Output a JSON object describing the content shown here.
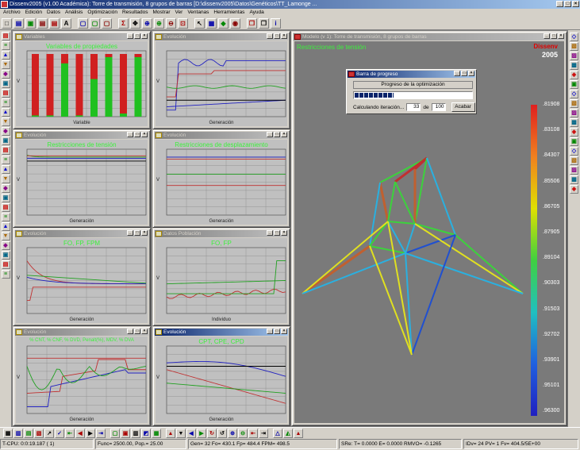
{
  "app": {
    "title": "Dissenv2005 (v1.00 Académica): Torre de transmisión, 8 grupos de barras [D:\\dissenv2005\\Datos\\Genéticos\\TT_Lamonge ...",
    "menu": [
      "Archivo",
      "Edición",
      "Datos",
      "Análisis",
      "Optimización",
      "Resultados",
      "Mostrar",
      "Ver",
      "Ventanas",
      "Herramientas",
      "Ayuda"
    ]
  },
  "toolbar": {
    "icons": [
      "new-icon",
      "open-icon",
      "save-icon",
      "print-icon",
      "print-icon",
      "text-icon",
      "frame-icon",
      "frame-icon",
      "frame-icon",
      "calc-icon",
      "move-icon",
      "zoom-icon",
      "zoom-in-icon",
      "zoom-out-icon",
      "zoom-fit-icon",
      "select-icon",
      "grid-icon",
      "render-icon",
      "color-icon",
      "cube-icon",
      "cube-icon",
      "info-icon"
    ],
    "glyphs": [
      "□",
      "▤",
      "▣",
      "▤",
      "▤",
      "A",
      "▢",
      "▢",
      "▢",
      "Σ",
      "✥",
      "⊕",
      "⊕",
      "⊖",
      "⊡",
      "↖",
      "▦",
      "◆",
      "◉",
      "❒",
      "❒",
      "i"
    ]
  },
  "windows": {
    "variables": {
      "title": "Variables",
      "plot_title": "Variables de propiedades",
      "xlabel": "Variable",
      "ylabel": "V",
      "colors": {
        "bar": "#d02020",
        "fill": "#20c020",
        "top": "#40ff40"
      }
    },
    "evol1": {
      "title": "Evolución",
      "xlabel": "Generación",
      "ylabel": "V"
    },
    "tension": {
      "title": "Evolución",
      "plot_title": "Restricciones de tensión",
      "xlabel": "Generación",
      "ylabel": "V"
    },
    "desplaz": {
      "title": "Evolución",
      "plot_title": "Restricciones de desplazamiento",
      "xlabel": "Generación",
      "ylabel": "V"
    },
    "fo": {
      "title": "Evolución",
      "plot_title": "FO, FP, FPM",
      "xlabel": "Generación",
      "ylabel": "V"
    },
    "poblacion": {
      "title": "Datos Población",
      "plot_title": "FO, FP",
      "xlabel": "Individuo",
      "ylabel": "V"
    },
    "pct": {
      "title": "Evolución",
      "plot_title": "% CNT, % CNF, % DVD, Penalt(%), MDV, % DVA",
      "xlabel": "Generación",
      "ylabel": "V"
    },
    "cpt": {
      "title": "Evolución",
      "plot_title": "CPT, CPE, CPD",
      "xlabel": "Generación",
      "ylabel": "V"
    },
    "model": {
      "title": "Modelo (v 1): Torre de transmisión, 8 grupos de barras",
      "subtitle": "Restricciones de tensión",
      "brand": "Dissenv",
      "year": "2005",
      "scale": [
        ".81908",
        ".83108",
        ".84307",
        ".85506",
        ".86705",
        ".87905",
        ".89104",
        ".90303",
        ".91503",
        ".92702",
        ".93901",
        ".95101",
        ".96300"
      ]
    }
  },
  "progress": {
    "title": "Barra de progreso",
    "label": "Progreso de la optimización",
    "iter_label": "Calculando iteración...",
    "current": "33",
    "of": "de",
    "total": "100",
    "fraction": 0.33,
    "stop_label": "Acabar"
  },
  "bottom_toolbar": {
    "glyphs": [
      "▦",
      "▥",
      "▤",
      "▧",
      "↗",
      "✓",
      "⇤",
      "◀",
      "▶",
      "⇥",
      "▢",
      "▣",
      "▥",
      "◩",
      "▦",
      "▲",
      "▼",
      "◀",
      "▶",
      "↻",
      "↺",
      "⊕",
      "⊖",
      "⇤",
      "⇥",
      "△",
      "◭",
      "▲"
    ]
  },
  "status": {
    "cpu": "T-CPU: 0:0:19.187 ( 1)",
    "func": "Func= 2500.00, Pop.= 25.00",
    "gen": "Gen= 32 Fo= 430.1 Fp= 484.4 FPM= 498.5",
    "s": "SRe: T= 0.0000 E= 0.0000 RMVO= -0.1265",
    "idv": "IDv= 24 PV= 1 Fv= 404.5/5E+00"
  }
}
